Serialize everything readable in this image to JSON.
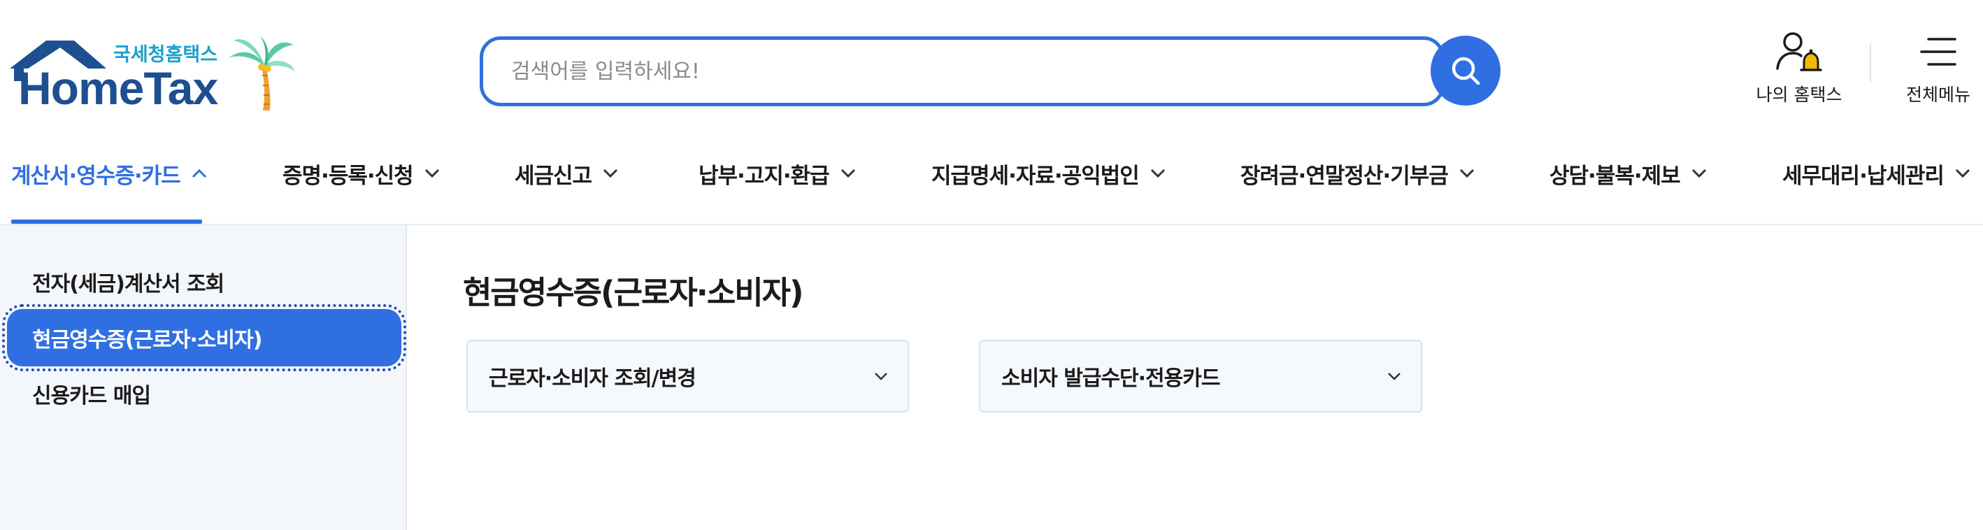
{
  "logo": {
    "sub_text": "국세청홈택스",
    "main_text": "HomeTax",
    "palm_icon": "palm-tree-icon",
    "house_icon": "house-roof-icon"
  },
  "search": {
    "placeholder": "검색어를 입력하세요!",
    "value": "",
    "button_icon": "search-icon"
  },
  "utility": {
    "my_hometax_label": "나의 홈택스",
    "my_hometax_icon": "user-bell-icon",
    "all_menu_label": "전체메뉴",
    "all_menu_icon": "hamburger-menu-icon"
  },
  "gnb": {
    "items": [
      {
        "label": "계산서·영수증·카드",
        "state": "expanded"
      },
      {
        "label": "증명·등록·신청",
        "state": "collapsed"
      },
      {
        "label": "세금신고",
        "state": "collapsed"
      },
      {
        "label": "납부·고지·환급",
        "state": "collapsed"
      },
      {
        "label": "지급명세·자료·공익법인",
        "state": "collapsed"
      },
      {
        "label": "장려금·연말정산·기부금",
        "state": "collapsed"
      },
      {
        "label": "상담·불복·제보",
        "state": "collapsed"
      },
      {
        "label": "세무대리·납세관리",
        "state": "collapsed"
      }
    ]
  },
  "sidebar": {
    "items": [
      {
        "label": "전자(세금)계산서 조회",
        "selected": false
      },
      {
        "label": "현금영수증(근로자·소비자)",
        "selected": true
      },
      {
        "label": "신용카드 매입",
        "selected": false
      }
    ]
  },
  "main": {
    "title": "현금영수증(근로자·소비자)",
    "dropdowns": [
      {
        "label": "근로자·소비자 조회/변경"
      },
      {
        "label": "소비자 발급수단·전용카드"
      }
    ]
  },
  "colors": {
    "accent": "#2f6fe2",
    "logo_navy": "#1d4f91",
    "logo_teal": "#1aa0c8",
    "sidebar_bg": "#f3f6fa"
  }
}
